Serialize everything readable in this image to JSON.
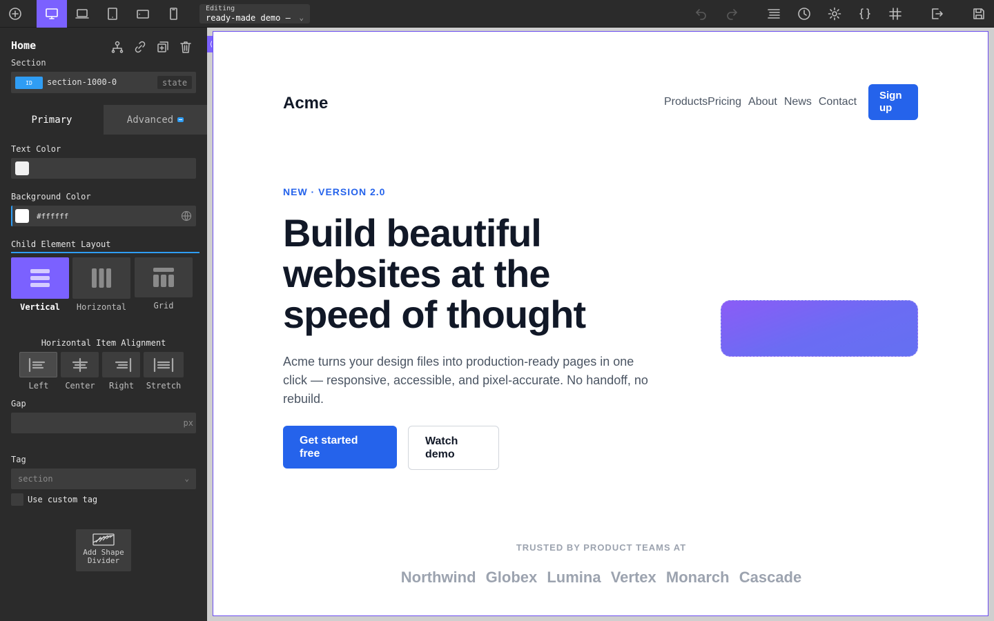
{
  "toolbar": {
    "editing_label": "Editing",
    "editing_value": "ready-made demo —",
    "icons": [
      "add-icon",
      "desktop-icon",
      "laptop-icon",
      "tablet-icon",
      "tablet-landscape-icon",
      "mobile-icon",
      "undo-icon",
      "redo-icon",
      "structure-icon",
      "history-icon",
      "settings-icon",
      "code-icon",
      "grid-icon",
      "exit-icon",
      "save-icon"
    ],
    "active_device": "desktop"
  },
  "sidebar": {
    "element_title": "Home",
    "element_type": "Section",
    "id_badge": "ID",
    "id_value": "section-1000-0",
    "state_label": "state",
    "tabs": [
      {
        "label": "Primary",
        "active": true
      },
      {
        "label": "Advanced",
        "active": false
      }
    ],
    "text_color_label": "Text Color",
    "text_color_swatch": "#f0f0f0",
    "bg_color_label": "Background Color",
    "bg_color_value": "#ffffff",
    "layout_label": "Child Element Layout",
    "layout_options": [
      {
        "label": "Vertical",
        "active": true
      },
      {
        "label": "Horizontal",
        "active": false
      },
      {
        "label": "Grid",
        "active": false
      }
    ],
    "align_label": "Horizontal Item Alignment",
    "align_options": [
      {
        "label": "Left",
        "active": true
      },
      {
        "label": "Center",
        "active": false
      },
      {
        "label": "Right",
        "active": false
      },
      {
        "label": "Stretch",
        "active": false
      }
    ],
    "gap_label": "Gap",
    "gap_unit": "px",
    "tag_label": "Tag",
    "tag_value": "section",
    "custom_tag_label": "Use custom tag",
    "shape_divider_label_1": "Add Shape",
    "shape_divider_label_2": "Divider"
  },
  "page": {
    "logo": "Acme",
    "nav_links": [
      "Products",
      "Pricing",
      "About",
      "News",
      "Contact"
    ],
    "signup_line1": "Sign",
    "signup_line2": "up",
    "eyebrow": "NEW · VERSION 2.0",
    "headline_1": "Build beautiful",
    "headline_2": "websites at the",
    "headline_3": "speed of thought",
    "subcopy_1": "Acme turns your design files into production-ready pages in one",
    "subcopy_2": "click — responsive, accessible, and pixel-accurate. No handoff, no",
    "subcopy_3": "rebuild.",
    "cta_primary_1": "Get started",
    "cta_primary_2": "free",
    "cta_secondary_1": "Watch",
    "cta_secondary_2": "demo",
    "trusted_label": "TRUSTED BY PRODUCT TEAMS AT",
    "logos": [
      "Northwind",
      "Globex",
      "Lumina",
      "Vertex",
      "Monarch",
      "Cascade"
    ]
  },
  "colors": {
    "accent": "#7b61ff",
    "primary_blue": "#2563eb",
    "info_blue": "#2f9df4"
  }
}
